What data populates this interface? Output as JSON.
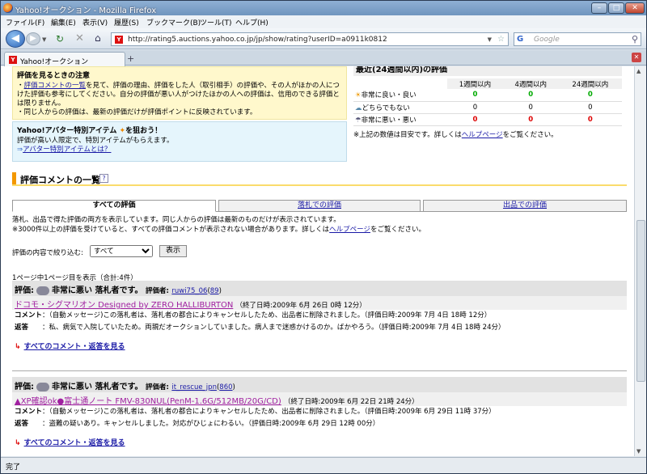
{
  "window": {
    "title": "Yahoo!オークション - Mozilla Firefox"
  },
  "menu": [
    "ファイル(F)",
    "編集(E)",
    "表示(V)",
    "履歴(S)",
    "ブックマーク(B)",
    "ツール(T)",
    "ヘルプ(H)"
  ],
  "nav": {
    "url": "http://rating5.auctions.yahoo.co.jp/jp/show/rating?userID=a0911k0812",
    "search_placeholder": "Google"
  },
  "tab": {
    "title": "Yahoo!オークション"
  },
  "notice": {
    "title": "評価を見るときの注意",
    "line1_link": "評価コメントの一覧",
    "line1_rest": "を見て、評価の理由、評価をした人（取引相手）の評価や、その人がほかの人につけた評価も参考にしてください。自分の評価が悪い人がつけたほかの人への評価は、信用のできる評価とは限りません。",
    "line2": "同じ人からの評価は、最新の評価だけが評価ポイントに反映されています。"
  },
  "avatar": {
    "title": "Yahoo!アバター特別アイテム",
    "title_suffix": "を狙おう！",
    "desc": "評価が高い人限定で、特別アイテムがもらえます。",
    "link": "アバター特別アイテムとは？"
  },
  "recent": {
    "title": "最近(24週間以内)の評価",
    "columns": [
      "1週間以内",
      "4週間以内",
      "24週間以内"
    ],
    "rows": [
      {
        "label": "非常に良い・良い",
        "values": [
          "0",
          "0",
          "0"
        ]
      },
      {
        "label": "どちらでもない",
        "values": [
          "0",
          "0",
          "0"
        ]
      },
      {
        "label": "非常に悪い・悪い",
        "values": [
          "0",
          "0",
          "0"
        ]
      }
    ],
    "note_pre": "※上記の数値は目安です。詳しくは",
    "note_link": "ヘルプページ",
    "note_post": "をご覧ください。"
  },
  "section": {
    "title": "評価コメントの一覧",
    "help": "?"
  },
  "comment_tabs": [
    "すべての評価",
    "落札での評価",
    "出品での評価"
  ],
  "desc": {
    "line1": "落札、出品で得た評価の両方を表示しています。同じ人からの評価は最新のものだけが表示されています。",
    "line2_pre": "※3000件以上の評価を受けていると、すべての評価コメントが表示されない場合があります。詳しくは",
    "line2_link": "ヘルプページ",
    "line2_post": "をご覧ください。"
  },
  "filter": {
    "label": "評価の内容で絞り込む:",
    "selected": "すべて",
    "button": "表示"
  },
  "pageinfo": "1ページ中1ページ目を表示（合計:4件）",
  "entries": [
    {
      "rating_label": "評価:",
      "rating": "非常に悪い 落札者です。",
      "by_label": "評価者:",
      "bidder": "ruwi75_06",
      "bidder_score": "89",
      "item": "ドコモ・シグマリオン Designed by ZERO HALLIBURTON",
      "end_time": "（終了日時:2009年 6月 26日 0時 12分）",
      "comment_label": "コメント",
      "comment": "：（自動メッセージ)この落札者は、落札者の都合によりキャンセルしたため、出品者に削除されました。（評価日時:2009年 7月 4日 18時 12分）",
      "reply_label": "返答",
      "reply": "：私、病気で入院していたため。両親だオークションしていました。病人まで迷惑かけるのか。ばかやろう。（評価日時:2009年 7月 4日 18時 24分）",
      "more": "すべてのコメント・返答を見る"
    },
    {
      "rating_label": "評価:",
      "rating": "非常に悪い 落札者です。",
      "by_label": "評価者:",
      "bidder": "it_rescue_jpn",
      "bidder_score": "860",
      "item": "▲XP確認ok●富士通ノート FMV-830NUL(PenM-1.6G/512MB/20G/CD)",
      "end_time": "（終了日時:2009年 6月 22日 21時 24分）",
      "comment_label": "コメント",
      "comment": "：（自動メッセージ)この落札者は、落札者の都合によりキャンセルしたため、出品者に削除されました。（評価日時:2009年 6月 29日 11時 37分）",
      "reply_label": "返答",
      "reply": "：盗難の疑いあり。キャンセルしました。対応がひじょにわるい。（評価日時:2009年 6月 29日 12時 00分）",
      "more": "すべてのコメント・返答を見る"
    }
  ],
  "status": "完了"
}
